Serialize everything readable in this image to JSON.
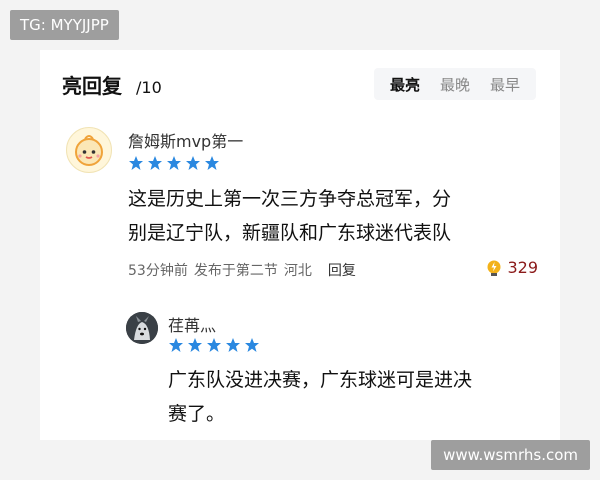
{
  "watermark": {
    "top_left": "TG: MYYJJPP",
    "bottom_right": "www.wsmrhs.com"
  },
  "header": {
    "title": "亮回复",
    "count": "/10"
  },
  "sort_tabs": [
    {
      "label": "最亮",
      "active": true
    },
    {
      "label": "最晚",
      "active": false
    },
    {
      "label": "最早",
      "active": false
    }
  ],
  "comment": {
    "username": "詹姆斯mvp第一",
    "rating": 5,
    "text_line1": "这是历史上第一次三方争夺总冠军，分",
    "text_line2": "别是辽宁队，新疆队和广东球迷代表队",
    "time": "53分钟前",
    "posted_in": "发布于第二节",
    "location": "河北",
    "reply_label": "回复",
    "likes": "329"
  },
  "reply": {
    "username": "荏苒灬",
    "rating": 5,
    "text_line1": "广东队没进决赛，广东球迷可是进决",
    "text_line2": "赛了。"
  },
  "colors": {
    "star": "#2a88e0",
    "likes": "#8b1a1a",
    "like_icon": "#f3b21a"
  }
}
